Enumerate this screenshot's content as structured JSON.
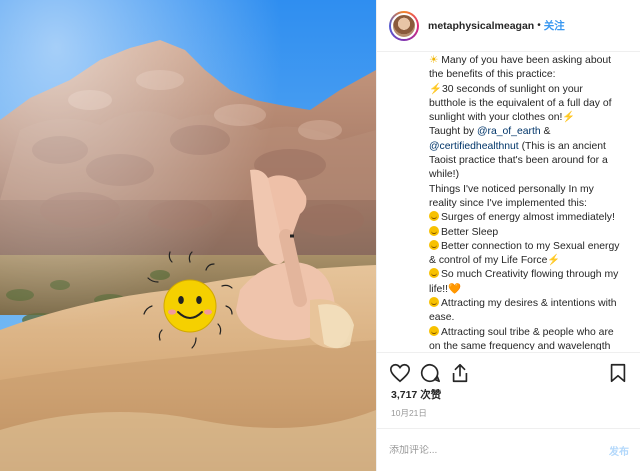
{
  "header": {
    "username": "metaphysicalmeagan",
    "separator": "•",
    "follow_label": "关注"
  },
  "caption_lines": [
    {
      "pre": "",
      "emoji": "sun",
      "text": " Many of you have been asking about"
    },
    {
      "pre": "",
      "emoji": "",
      "text": "the benefits of this practice:"
    },
    {
      "pre": "",
      "emoji": "bolt",
      "text": "30 seconds of sunlight on your"
    },
    {
      "pre": "",
      "emoji": "",
      "text": "butthole is the equivalent of a full day of"
    },
    {
      "pre": "",
      "emoji": "",
      "text": "sunlight with your clothes on!"
    },
    {
      "pre": "",
      "emoji": "",
      "text": "Taught by "
    },
    {
      "pre": "",
      "emoji": "",
      "text": "@certifiedhealthnut"
    },
    {
      "pre": "",
      "emoji": "",
      "text": "Taoist practice that's been around for a"
    },
    {
      "pre": "",
      "emoji": "",
      "text": "while!)"
    },
    {
      "pre": "",
      "emoji": "",
      "text": "Things I've noticed personally In my"
    },
    {
      "pre": "",
      "emoji": "",
      "text": "reality since I've implemented this:"
    },
    {
      "pre": "",
      "emoji": "smile",
      "text": "Surges of energy almost immediately!"
    },
    {
      "pre": "",
      "emoji": "smile",
      "text": "Better Sleep"
    },
    {
      "pre": "",
      "emoji": "smile",
      "text": "Better connection to my Sexual energy"
    },
    {
      "pre": "",
      "emoji": "",
      "text": "& control of my Life Force"
    },
    {
      "pre": "",
      "emoji": "smile",
      "text": "So much Creativity flowing through my"
    },
    {
      "pre": "",
      "emoji": "",
      "text": "life!!"
    },
    {
      "pre": "",
      "emoji": "smile",
      "text": "Attracting my desires & intentions with"
    },
    {
      "pre": "",
      "emoji": "",
      "text": "ease."
    },
    {
      "pre": "",
      "emoji": "smile",
      "text": "Attracting soul tribe & people who are"
    },
    {
      "pre": "",
      "emoji": "",
      "text": "on the same frequency and wavelength"
    }
  ],
  "caption": {
    "taught_by_mention": "@ra_of_earth",
    "amp": " &",
    "certified_suffix": " (This is an ancient",
    "bolt_after_clothes": "⚡",
    "bolt_after_force": "⚡",
    "heart_after_life": "🧡"
  },
  "engagement": {
    "likes": "3,717 次赞",
    "date": "10月21日"
  },
  "comment": {
    "placeholder": "添加评论...",
    "post_label": "发布"
  },
  "colors": {
    "link_blue": "#3897f0",
    "text": "#262626",
    "muted": "#999999",
    "post_disabled": "#b3d8fb"
  },
  "icons": [
    "heart-icon",
    "comment-icon",
    "share-icon",
    "bookmark-icon",
    "smiley-sticker"
  ]
}
